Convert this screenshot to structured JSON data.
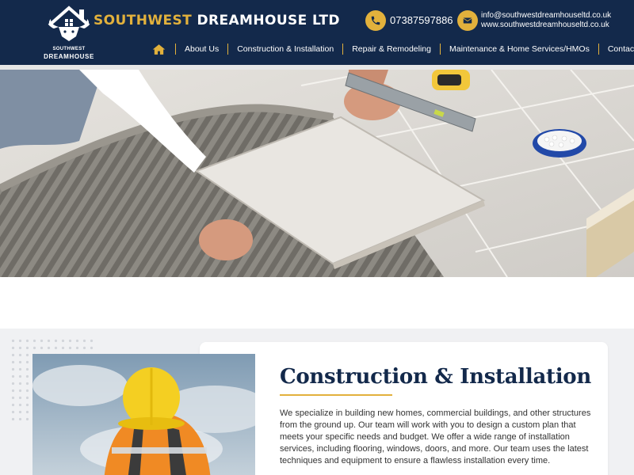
{
  "header": {
    "logo": {
      "line1": "SOUTHWEST",
      "line2": "DREAMHOUSE"
    },
    "brand": {
      "part1": "SOUTHWEST",
      "part2": " DREAMHOUSE LTD"
    },
    "phone": "07387597886",
    "email": "info@southwestdreamhouseltd.co.uk",
    "website": "www.southwestdreamhouseltd.co.uk",
    "icons": {
      "phone": "phone-icon",
      "mail": "mail-icon",
      "home": "home-icon"
    }
  },
  "nav": {
    "items": [
      {
        "label": "About Us"
      },
      {
        "label": "Construction & Installation"
      },
      {
        "label": "Repair & Remodeling"
      },
      {
        "label": "Maintenance & Home Services/HMOs"
      },
      {
        "label": "Contact Us"
      }
    ]
  },
  "section": {
    "title": "Construction & Installation",
    "body": "We specialize in building new homes, commercial buildings, and other structures from the ground up. Our team will work with you to design a custom plan that meets your specific needs and budget. We offer a wide range of installation services, including flooring, windows, doors, and more. Our team uses the latest techniques and equipment to ensure a flawless installation every time."
  },
  "colors": {
    "navy": "#13294b",
    "gold": "#e2b13c",
    "section_bg": "#f0f1f3"
  }
}
